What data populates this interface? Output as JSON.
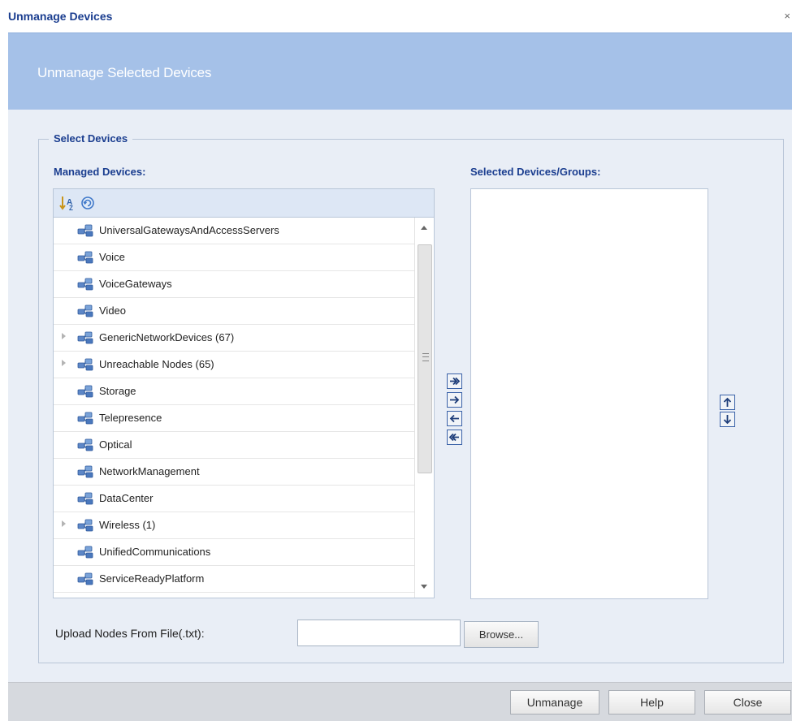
{
  "dialog": {
    "title": "Unmanage Devices",
    "close_glyph": "×",
    "banner_title": "Unmanage Selected Devices"
  },
  "select_devices": {
    "legend": "Select Devices",
    "managed_label": "Managed Devices:",
    "selected_label": "Selected Devices/Groups:",
    "toolbar_icons": [
      "sort-icon",
      "refresh-icon"
    ],
    "tree_items": [
      {
        "label": "UniversalGatewaysAndAccessServers",
        "expandable": false
      },
      {
        "label": "Voice",
        "expandable": false
      },
      {
        "label": "VoiceGateways",
        "expandable": false
      },
      {
        "label": "Video",
        "expandable": false
      },
      {
        "label": "GenericNetworkDevices (67)",
        "expandable": true
      },
      {
        "label": "Unreachable Nodes (65)",
        "expandable": true
      },
      {
        "label": "Storage",
        "expandable": false
      },
      {
        "label": "Telepresence",
        "expandable": false
      },
      {
        "label": "Optical",
        "expandable": false
      },
      {
        "label": "NetworkManagement",
        "expandable": false
      },
      {
        "label": "DataCenter",
        "expandable": false
      },
      {
        "label": "Wireless (1)",
        "expandable": true
      },
      {
        "label": "UnifiedCommunications",
        "expandable": false
      },
      {
        "label": "ServiceReadyPlatform",
        "expandable": false
      }
    ],
    "selected_items": [],
    "transfer_buttons": [
      "add-all-icon",
      "add-icon",
      "remove-icon",
      "remove-all-icon"
    ],
    "order_buttons": [
      "move-up-icon",
      "move-down-icon"
    ]
  },
  "upload": {
    "label": "Upload Nodes From File(.txt):",
    "value": "",
    "browse_label": "Browse..."
  },
  "footer": {
    "unmanage_label": "Unmanage",
    "help_label": "Help",
    "close_label": "Close"
  },
  "colors": {
    "title_text": "#1a3d8f",
    "banner_bg": "#a5c1e8",
    "body_bg": "#e9eef6",
    "footer_bg": "#d6d9de",
    "button_border": "#3a62a8"
  }
}
